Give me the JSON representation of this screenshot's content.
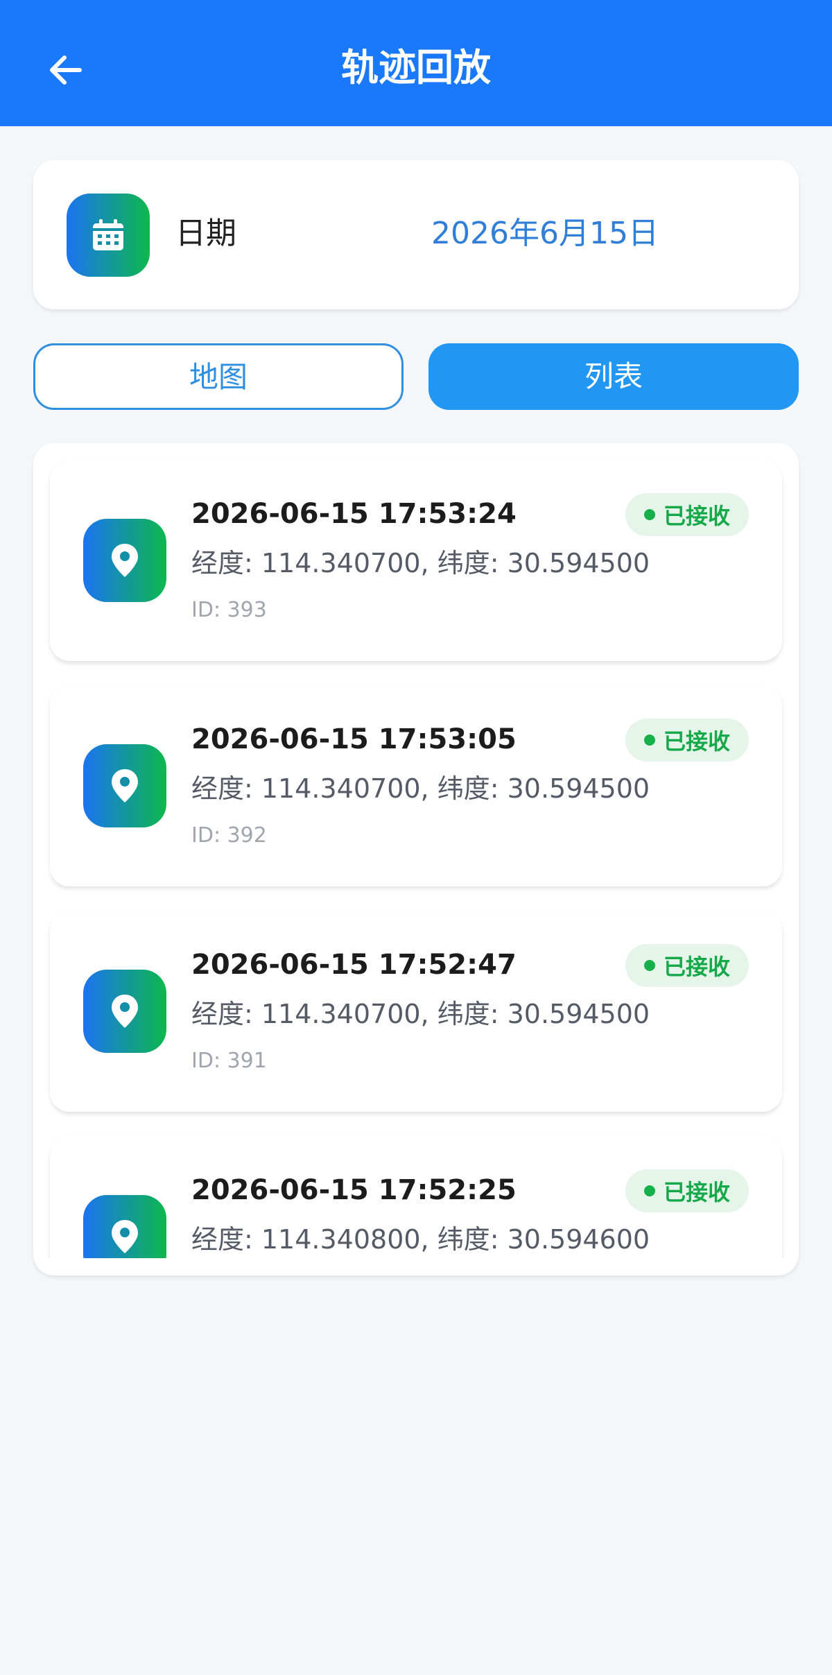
{
  "header": {
    "title": "轨迹回放",
    "back_icon": "arrow-left-icon"
  },
  "date": {
    "label": "日期",
    "value": "2026年6月15日",
    "icon": "calendar-icon"
  },
  "view_toggle": {
    "map_label": "地图",
    "list_label": "列表",
    "active": "list"
  },
  "records": [
    {
      "time": "2026-06-15 17:53:24",
      "coords": "经度: 114.340700, 纬度: 30.594500",
      "id": "ID: 393",
      "status": "已接收"
    },
    {
      "time": "2026-06-15 17:53:05",
      "coords": "经度: 114.340700, 纬度: 30.594500",
      "id": "ID: 392",
      "status": "已接收"
    },
    {
      "time": "2026-06-15 17:52:47",
      "coords": "经度: 114.340700, 纬度: 30.594500",
      "id": "ID: 391",
      "status": "已接收"
    },
    {
      "time": "2026-06-15 17:52:25",
      "coords": "经度: 114.340800, 纬度: 30.594600",
      "id": "",
      "status": "已接收"
    }
  ],
  "colors": {
    "header_bg": "#1a78fa",
    "accent_blue": "#2196f3",
    "status_green": "#16a94a",
    "icon_gradient_start": "#1b74f2",
    "icon_gradient_end": "#0db84c"
  }
}
